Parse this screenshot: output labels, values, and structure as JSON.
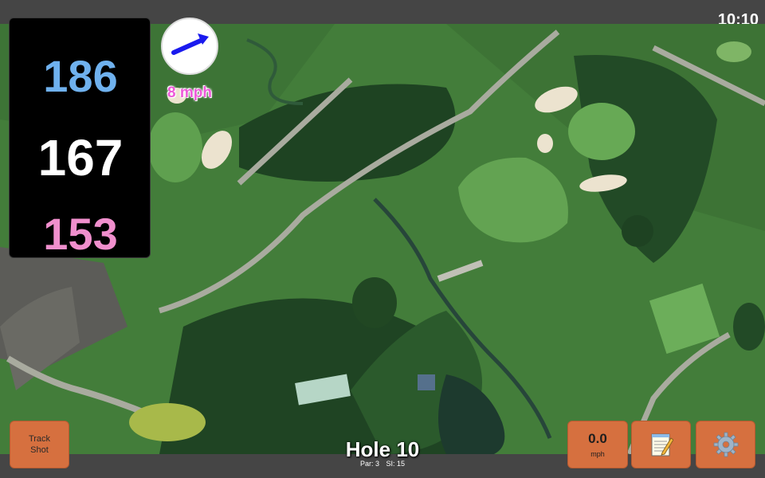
{
  "status": {
    "time": "10:10"
  },
  "distances": {
    "back": "186",
    "middle": "167",
    "front": "153"
  },
  "wind": {
    "speed_label": "8 mph",
    "icon": "wind-direction-arrow-icon"
  },
  "hole": {
    "title": "Hole 10",
    "par_label": "Par: 3",
    "si_label": "SI: 15"
  },
  "buttons": {
    "track_shot_line1": "Track",
    "track_shot_line2": "Shot",
    "speed_value": "0.0",
    "speed_unit": "mph",
    "notes_icon": "notepad-icon",
    "settings_icon": "gear-icon"
  },
  "colors": {
    "back_distance": "#6fb1ee",
    "middle_distance": "#ffffff",
    "front_distance": "#f08fcd",
    "wind_text": "#ee5ad9",
    "button": "#d6703f"
  }
}
